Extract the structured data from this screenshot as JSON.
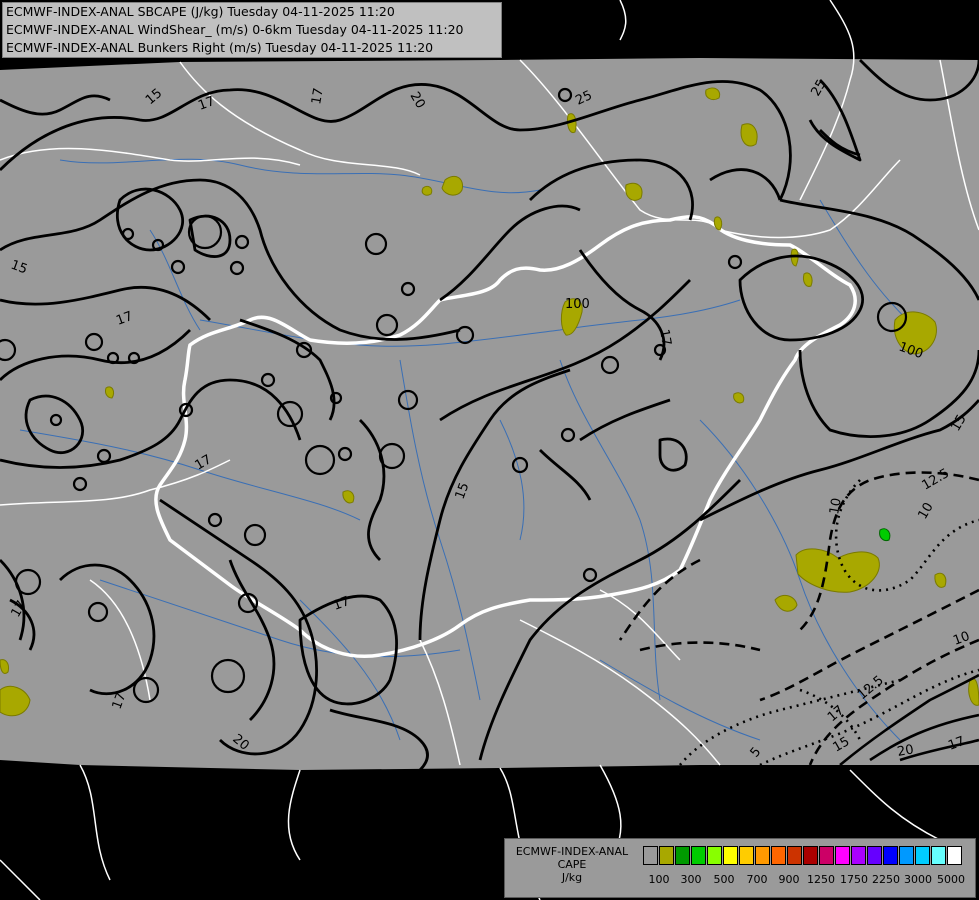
{
  "header": {
    "lines": [
      "ECMWF-INDEX-ANAL SBCAPE (J/kg) Tuesday 04-11-2025 11:20",
      "ECMWF-INDEX-ANAL WindShear_ (m/s) 0-6km Tuesday 04-11-2025 11:20",
      "ECMWF-INDEX-ANAL Bunkers Right (m/s) Tuesday 04-11-2025 11:20"
    ]
  },
  "contour_labels": [
    {
      "text": "15"
    },
    {
      "text": "17"
    },
    {
      "text": "17"
    },
    {
      "text": "20"
    },
    {
      "text": "25"
    },
    {
      "text": "25"
    },
    {
      "text": "15"
    },
    {
      "text": "17"
    },
    {
      "text": "100"
    },
    {
      "text": "17"
    },
    {
      "text": "100"
    },
    {
      "text": "15"
    },
    {
      "text": "17"
    },
    {
      "text": "15"
    },
    {
      "text": "12.5"
    },
    {
      "text": "10"
    },
    {
      "text": "10"
    },
    {
      "text": "17"
    },
    {
      "text": "17"
    },
    {
      "text": "17"
    },
    {
      "text": "20"
    },
    {
      "text": "10"
    },
    {
      "text": "12.5"
    },
    {
      "text": "17"
    },
    {
      "text": "5"
    },
    {
      "text": "15"
    },
    {
      "text": "20"
    },
    {
      "text": "17"
    }
  ],
  "legend": {
    "title_lines": [
      "ECMWF-INDEX-ANAL",
      "CAPE",
      "J/kg"
    ],
    "colors": [
      "#9a9a9a",
      "#a8a800",
      "#009a00",
      "#00cc00",
      "#88ff00",
      "#ffff00",
      "#ffcc00",
      "#ff9900",
      "#ff6600",
      "#cc3300",
      "#aa0000",
      "#cc0066",
      "#ff00ff",
      "#aa00ff",
      "#6600ff",
      "#0000ff",
      "#0099ff",
      "#00ccff",
      "#66ffff",
      "#ffffff"
    ],
    "tick_labels": [
      "100",
      "300",
      "500",
      "700",
      "900",
      "1250",
      "1750",
      "2250",
      "3000",
      "5000"
    ]
  }
}
